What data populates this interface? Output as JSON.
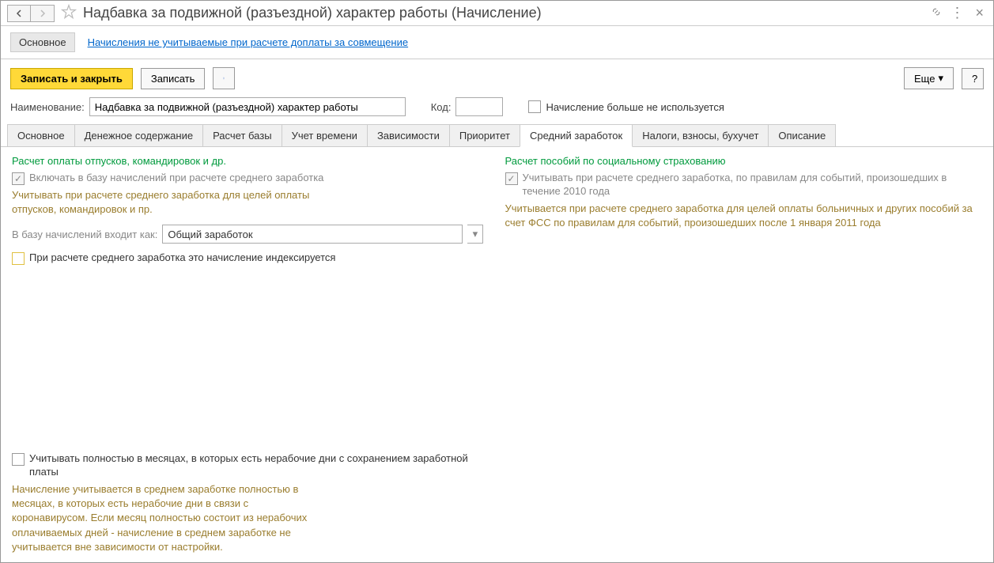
{
  "title": "Надбавка за подвижной (разъездной) характер работы (Начисление)",
  "top_tabs": {
    "main": "Основное",
    "link": "Начисления не учитываемые при расчете доплаты за совмещение"
  },
  "toolbar": {
    "save_close": "Записать и закрыть",
    "save": "Записать",
    "more": "Еще",
    "help": "?"
  },
  "form": {
    "name_label": "Наименование:",
    "name_value": "Надбавка за подвижной (разъездной) характер работы",
    "code_label": "Код:",
    "code_value": "",
    "not_used_label": "Начисление больше не используется"
  },
  "tabs": [
    "Основное",
    "Денежное содержание",
    "Расчет базы",
    "Учет времени",
    "Зависимости",
    "Приоритет",
    "Средний заработок",
    "Налоги, взносы, бухучет",
    "Описание"
  ],
  "active_tab": 6,
  "left": {
    "title": "Расчет оплаты отпусков, командировок и др.",
    "include_label": "Включать в базу начислений при расчете среднего заработка",
    "include_hint": "Учитывать при расчете среднего заработка для целей оплаты отпусков, командировок и пр.",
    "base_label": "В базу начислений входит как:",
    "base_value": "Общий заработок",
    "index_label": "При расчете среднего заработка это начисление индексируется"
  },
  "right": {
    "title": "Расчет пособий по социальному страхованию",
    "include_label": "Учитывать при расчете среднего заработка, по правилам для событий, произошедших в течение 2010 года",
    "include_hint": "Учитывается при расчете среднего заработка для целей оплаты больничных и других пособий за счет ФСС по правилам для событий, произошедших после 1 января 2011 года"
  },
  "bottom": {
    "check_label": "Учитывать полностью в месяцах, в которых есть нерабочие дни с сохранением заработной платы",
    "hint": "Начисление учитывается в среднем заработке полностью в месяцах, в которых есть нерабочие дни в связи с коронавирусом. Если месяц полностью состоит из нерабочих оплачиваемых дней - начисление в среднем заработке не учитывается вне зависимости от настройки."
  }
}
